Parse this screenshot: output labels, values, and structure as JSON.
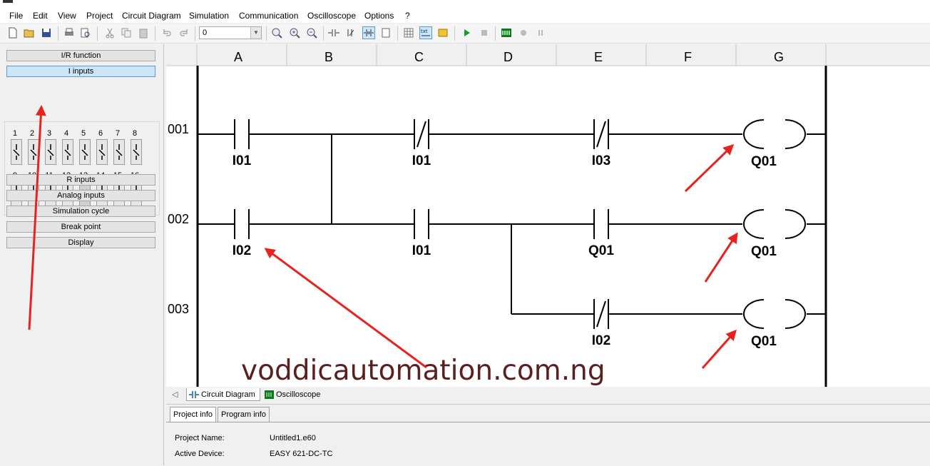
{
  "menu": [
    "File",
    "Edit",
    "View",
    "Project",
    "Circuit Diagram",
    "Simulation",
    "Communication",
    "Oscilloscope",
    "Options",
    "?"
  ],
  "toolbar": {
    "combo_value": "0",
    "icons": [
      "new-icon",
      "open-icon",
      "save-icon",
      "print-icon",
      "print-preview-icon",
      "cut-icon",
      "copy-icon",
      "paste-icon",
      "undo-icon",
      "redo-icon",
      "zoom-fit-icon",
      "zoom-in-icon",
      "zoom-out-icon",
      "contact-icon",
      "coil-icon",
      "connection-icon",
      "page-icon",
      "grid-icon",
      "text-icon",
      "color-icon",
      "play-icon",
      "stop-icon",
      "oscilloscope-icon",
      "record-icon",
      "pause-icon"
    ]
  },
  "left_panel": {
    "sections_top": [
      "I/R function",
      "I inputs"
    ],
    "sections_bottom": [
      "R inputs",
      "Analog inputs",
      "Simulation cycle",
      "Break point",
      "Display"
    ],
    "input_numbers_row1": [
      "1",
      "2",
      "3",
      "4",
      "5",
      "6",
      "7",
      "8"
    ],
    "input_numbers_row2": [
      "9",
      "10",
      "11",
      "12",
      "13",
      "14",
      "15",
      "16"
    ],
    "disabled_mark": "X"
  },
  "diagram": {
    "columns": [
      "A",
      "B",
      "C",
      "D",
      "E",
      "F",
      "G"
    ],
    "rows": [
      "001",
      "002",
      "003"
    ],
    "contact_labels": {
      "r1a": "I01",
      "r1c": "I01",
      "r1e": "I03",
      "r1g": "Q01",
      "r2a": "I02",
      "r2c": "I01",
      "r2e": "Q01",
      "r2g": "Q01",
      "r3e": "I02",
      "r3g": "Q01"
    }
  },
  "tabs": [
    "Circuit Diagram",
    "Oscilloscope"
  ],
  "info": {
    "tabs": [
      "Project info",
      "Program info"
    ],
    "project_name_label": "Project Name:",
    "project_name": "Untitled1.e60",
    "active_device_label": "Active Device:",
    "active_device": "EASY 621-DC-TC"
  },
  "watermark": "voddicautomation.com.ng",
  "colors": {
    "annotation_arrow": "#e8231f",
    "watermark": "#5a1f1f",
    "selected_section": "#cde6f7"
  }
}
